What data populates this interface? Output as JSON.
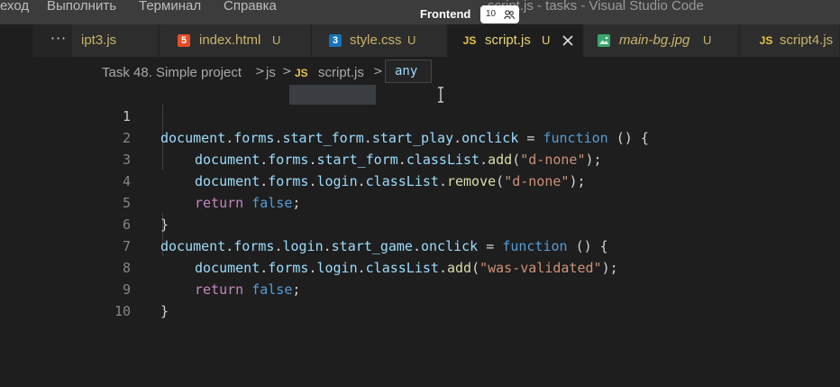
{
  "menu": [
    "еход",
    "Выполнить",
    "Терминал",
    "Справка"
  ],
  "window_title": "script.js - tasks - Visual Studio Code",
  "overlay": {
    "label": "Frontend",
    "badge": "10"
  },
  "tabs": [
    {
      "label": "ipt3.js",
      "icon": "js-icon",
      "status": ""
    },
    {
      "label": "index.html",
      "icon": "html5-icon",
      "status": "U"
    },
    {
      "label": "style.css",
      "icon": "css3-icon",
      "status": "U"
    },
    {
      "label": "script.js",
      "icon": "js-icon",
      "status": "U",
      "active": true
    },
    {
      "label": "main-bg.jpg",
      "icon": "image-icon",
      "status": "U"
    },
    {
      "label": "script4.js",
      "icon": "js-icon",
      "status": ""
    }
  ],
  "icons": {
    "js": "JS",
    "html": "5",
    "css": "3"
  },
  "breadcrumb": [
    "Task 48. Simple project",
    "js",
    "script.js"
  ],
  "hover_tip": "any",
  "code": {
    "line_numbers": [
      "1",
      "2",
      "3",
      "4",
      "5",
      "6",
      "7",
      "8",
      "9",
      "10"
    ],
    "l1": [
      "document",
      ".",
      "forms",
      ".",
      "start_form",
      ".",
      "start_play",
      ".",
      "onclick",
      " = ",
      "function",
      " () {"
    ],
    "l2": [
      "document",
      ".",
      "forms",
      ".",
      "start_form",
      ".",
      "classList",
      ".",
      "add",
      "(",
      "\"d-none\"",
      ");"
    ],
    "l3": [
      "document",
      ".",
      "forms",
      ".",
      "login",
      ".",
      "classList",
      ".",
      "remove",
      "(",
      "\"d-none\"",
      ");"
    ],
    "l4": [
      "return",
      " ",
      "false",
      ";"
    ],
    "l5": [
      "}"
    ],
    "l6": [
      "document",
      ".",
      "forms",
      ".",
      "login",
      ".",
      "start_game",
      ".",
      "onclick",
      " = ",
      "function",
      " () {"
    ],
    "l7": [
      "document",
      ".",
      "forms",
      ".",
      "login",
      ".",
      "classList",
      ".",
      "add",
      "(",
      "\"was-validated\"",
      ");"
    ],
    "l8": [
      "return",
      " ",
      "false",
      ";"
    ],
    "l9": [
      "}"
    ]
  },
  "colors": {
    "editor_bg": "#1e1e1e",
    "tab_active_bg": "#1e1e1e",
    "tab_inactive_bg": "#2d2d2d",
    "modified_text": "#e8d57a",
    "keyword": "#569cd6",
    "control": "#c586c0",
    "string": "#ce9178",
    "function": "#dcdcaa",
    "variable": "#9cdcfe"
  }
}
